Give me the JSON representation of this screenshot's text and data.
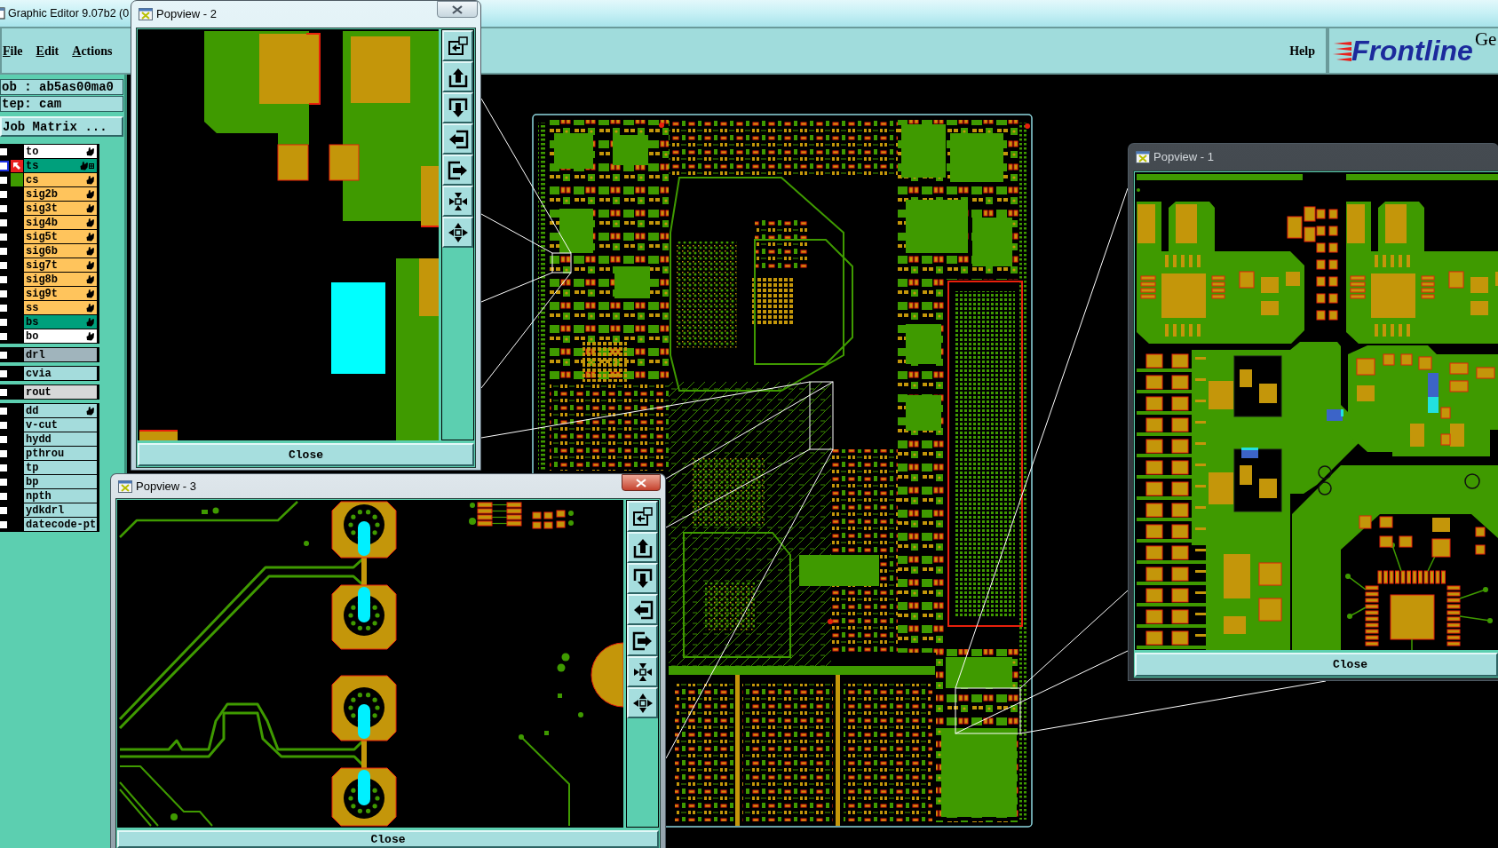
{
  "window": {
    "title": "Graphic Editor 9.07b2 (0"
  },
  "menu": [
    {
      "label": "File"
    },
    {
      "label": "Edit"
    },
    {
      "label": "Actions"
    }
  ],
  "help": {
    "label": "Help"
  },
  "logo": {
    "brand": "Frontline",
    "product": "Ge"
  },
  "job_panel": {
    "job": "ob : ab5as00ma0",
    "step": "tep: cam",
    "matrix_button": "Job Matrix ..."
  },
  "layer_groups": [
    {
      "layers": [
        {
          "name": "to",
          "checked": false,
          "work": false,
          "color": "#ffffff",
          "hand": true,
          "grid_mark": false
        },
        {
          "name": "ts",
          "checked": false,
          "work": true,
          "color": "#00a07c",
          "hand": true,
          "grid_mark": true
        },
        {
          "name": "cs",
          "checked": false,
          "work": false,
          "color": "#ffc45c",
          "hand": true,
          "grid_mark": false,
          "display": {
            "color": "#3f9a00"
          }
        },
        {
          "name": "sig2b",
          "checked": false,
          "work": false,
          "color": "#ffc45c",
          "hand": true,
          "grid_mark": false
        },
        {
          "name": "sig3t",
          "checked": false,
          "work": false,
          "color": "#ffc45c",
          "hand": true,
          "grid_mark": false
        },
        {
          "name": "sig4b",
          "checked": false,
          "work": false,
          "color": "#ffc45c",
          "hand": true,
          "grid_mark": false
        },
        {
          "name": "sig5t",
          "checked": false,
          "work": false,
          "color": "#ffc45c",
          "hand": true,
          "grid_mark": false
        },
        {
          "name": "sig6b",
          "checked": false,
          "work": false,
          "color": "#ffc45c",
          "hand": true,
          "grid_mark": false
        },
        {
          "name": "sig7t",
          "checked": false,
          "work": false,
          "color": "#ffc45c",
          "hand": true,
          "grid_mark": false
        },
        {
          "name": "sig8b",
          "checked": false,
          "work": false,
          "color": "#ffc45c",
          "hand": true,
          "grid_mark": false
        },
        {
          "name": "sig9t",
          "checked": false,
          "work": false,
          "color": "#ffc45c",
          "hand": true,
          "grid_mark": false
        },
        {
          "name": "ss",
          "checked": false,
          "work": false,
          "color": "#ffc45c",
          "hand": true,
          "grid_mark": false
        },
        {
          "name": "bs",
          "checked": false,
          "work": false,
          "color": "#00a07c",
          "hand": true,
          "grid_mark": false
        },
        {
          "name": "bo",
          "checked": false,
          "work": false,
          "color": "#ffffff",
          "hand": true,
          "grid_mark": false
        }
      ]
    },
    {
      "layers": [
        {
          "name": "drl",
          "checked": false,
          "work": false,
          "color": "#a0b4bc",
          "hand": false,
          "grid_mark": false
        }
      ]
    },
    {
      "layers": [
        {
          "name": "cvia",
          "checked": false,
          "work": false,
          "color": "#a4dcdc",
          "hand": false,
          "grid_mark": false
        }
      ]
    },
    {
      "layers": [
        {
          "name": "rout",
          "checked": false,
          "work": false,
          "color": "#d6d8d8",
          "hand": false,
          "grid_mark": false
        }
      ]
    },
    {
      "layers": [
        {
          "name": "dd",
          "checked": false,
          "work": false,
          "color": "#a4dcdc",
          "hand": true,
          "grid_mark": false
        },
        {
          "name": "v-cut",
          "checked": false,
          "work": false,
          "color": "#a4dcdc",
          "hand": false,
          "grid_mark": false
        },
        {
          "name": "hydd",
          "checked": false,
          "work": false,
          "color": "#a4dcdc",
          "hand": false,
          "grid_mark": false
        },
        {
          "name": "pthrou",
          "checked": false,
          "work": false,
          "color": "#a4dcdc",
          "hand": false,
          "grid_mark": false
        },
        {
          "name": "tp",
          "checked": false,
          "work": false,
          "color": "#a4dcdc",
          "hand": false,
          "grid_mark": false
        },
        {
          "name": "bp",
          "checked": false,
          "work": false,
          "color": "#a4dcdc",
          "hand": false,
          "grid_mark": false
        },
        {
          "name": "npth",
          "checked": false,
          "work": false,
          "color": "#a4dcdc",
          "hand": false,
          "grid_mark": false
        },
        {
          "name": "ydkdrl",
          "checked": false,
          "work": false,
          "color": "#a4dcdc",
          "hand": false,
          "grid_mark": false
        },
        {
          "name": "datecode-pt",
          "checked": false,
          "work": false,
          "color": "#a4dcdc",
          "hand": false,
          "grid_mark": false
        }
      ]
    }
  ],
  "popviews": [
    {
      "title": "Popview - 2",
      "active": false,
      "close_label": "Close"
    },
    {
      "title": "Popview - 1",
      "close_label": "Close"
    },
    {
      "title": "Popview - 3",
      "active": true,
      "close_label": "Close"
    }
  ]
}
